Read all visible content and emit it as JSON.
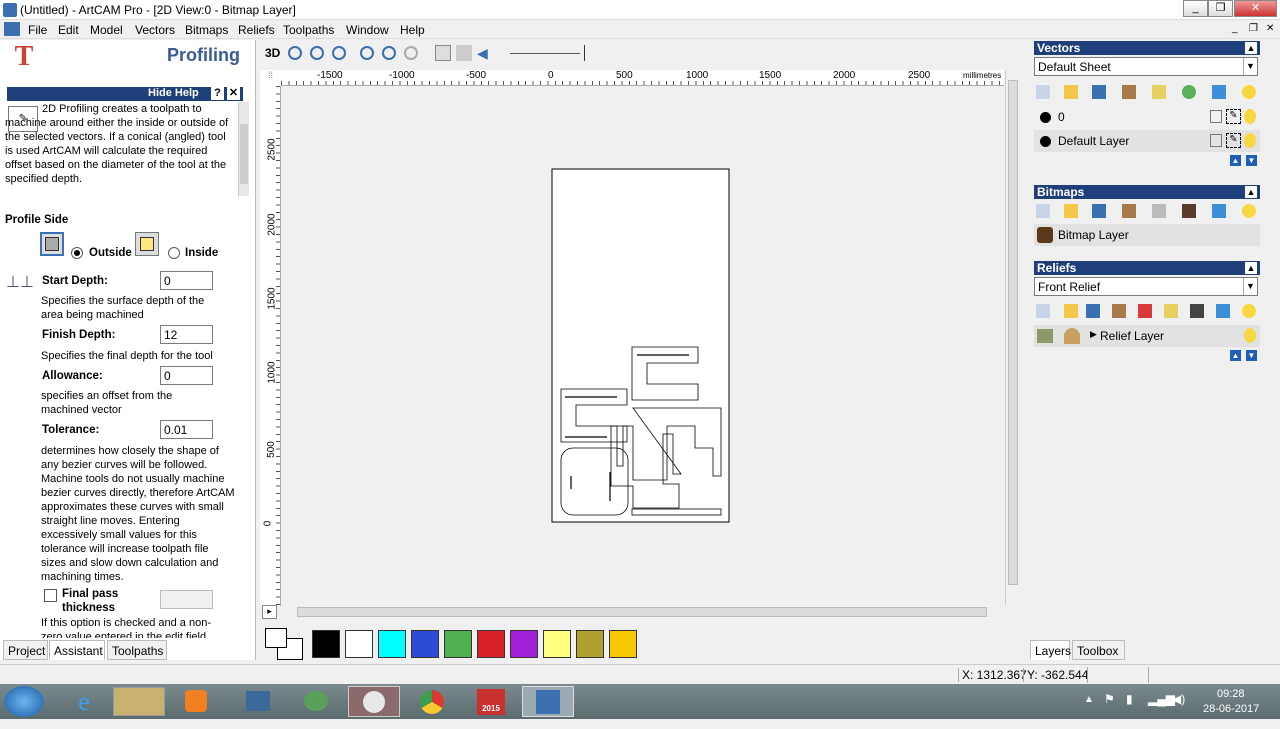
{
  "window": {
    "title": "(Untitled) - ArtCAM Pro - [2D View:0 - Bitmap Layer]"
  },
  "menu": [
    "File",
    "Edit",
    "Model",
    "Vectors",
    "Bitmaps",
    "Reliefs",
    "Toolpaths",
    "Window",
    "Help"
  ],
  "assistant": {
    "title": "Profiling",
    "hide_help": "Hide Help",
    "help_text": "2D Profiling creates a toolpath to machine around either the inside or outside of the selected vectors. If a conical (angled) tool is used ArtCAM will calculate the required offset based on the diameter of the tool at the specified depth.",
    "profile_side_label": "Profile Side",
    "outside_label": "Outside",
    "inside_label": "Inside",
    "start_depth_label": "Start Depth:",
    "start_depth_value": "0",
    "start_depth_help": "Specifies the surface depth of the area being machined",
    "finish_depth_label": "Finish Depth:",
    "finish_depth_value": "12",
    "finish_depth_help": "Specifies the final depth for the tool",
    "allowance_label": "Allowance:",
    "allowance_value": "0",
    "allowance_help": "specifies an offset from the machined vector",
    "tolerance_label": "Tolerance:",
    "tolerance_value": "0.01",
    "tolerance_help": "determines how closely the shape of any bezier curves will be followed. Machine tools do not usually machine bezier curves directly, therefore ArtCAM approximates these curves with small straight line moves. Entering excessively small values for this tolerance will increase toolpath file sizes and slow down calculation and machining times.",
    "final_pass_label": "Final pass thickness",
    "final_pass_help": "If this option is checked and a non-zero value entered in the edit field"
  },
  "left_tabs": [
    "Project",
    "Assistant",
    "Toolpaths"
  ],
  "toolbar": {
    "view3d": "3D"
  },
  "ruler": {
    "h_ticks": [
      "-1500",
      "-1000",
      "-500",
      "0",
      "500",
      "1000",
      "1500",
      "2000",
      "2500"
    ],
    "units": "millimetres",
    "v_ticks": [
      "2500",
      "2000",
      "1500",
      "1000",
      "500",
      "0"
    ]
  },
  "palette": {
    "colors": [
      "#000000",
      "#ffffff",
      "#00ffff",
      "#2e4bd8",
      "#4fb04f",
      "#d8202a",
      "#a020d8",
      "#ffff80",
      "#b0a030",
      "#f8c800"
    ]
  },
  "vectors": {
    "title": "Vectors",
    "sheet": "Default Sheet",
    "layers": [
      "0",
      "Default Layer"
    ]
  },
  "bitmaps": {
    "title": "Bitmaps",
    "layer": "Bitmap Layer"
  },
  "reliefs": {
    "title": "Reliefs",
    "relief": "Front Relief",
    "layer": "Relief Layer"
  },
  "right_tabs": [
    "Layers",
    "Toolbox"
  ],
  "status": {
    "x": "X: 1312.367",
    "y": "Y: -362.544"
  },
  "clock": {
    "time": "09:28",
    "date": "28-06-2017"
  },
  "taskbar_label": "2015"
}
